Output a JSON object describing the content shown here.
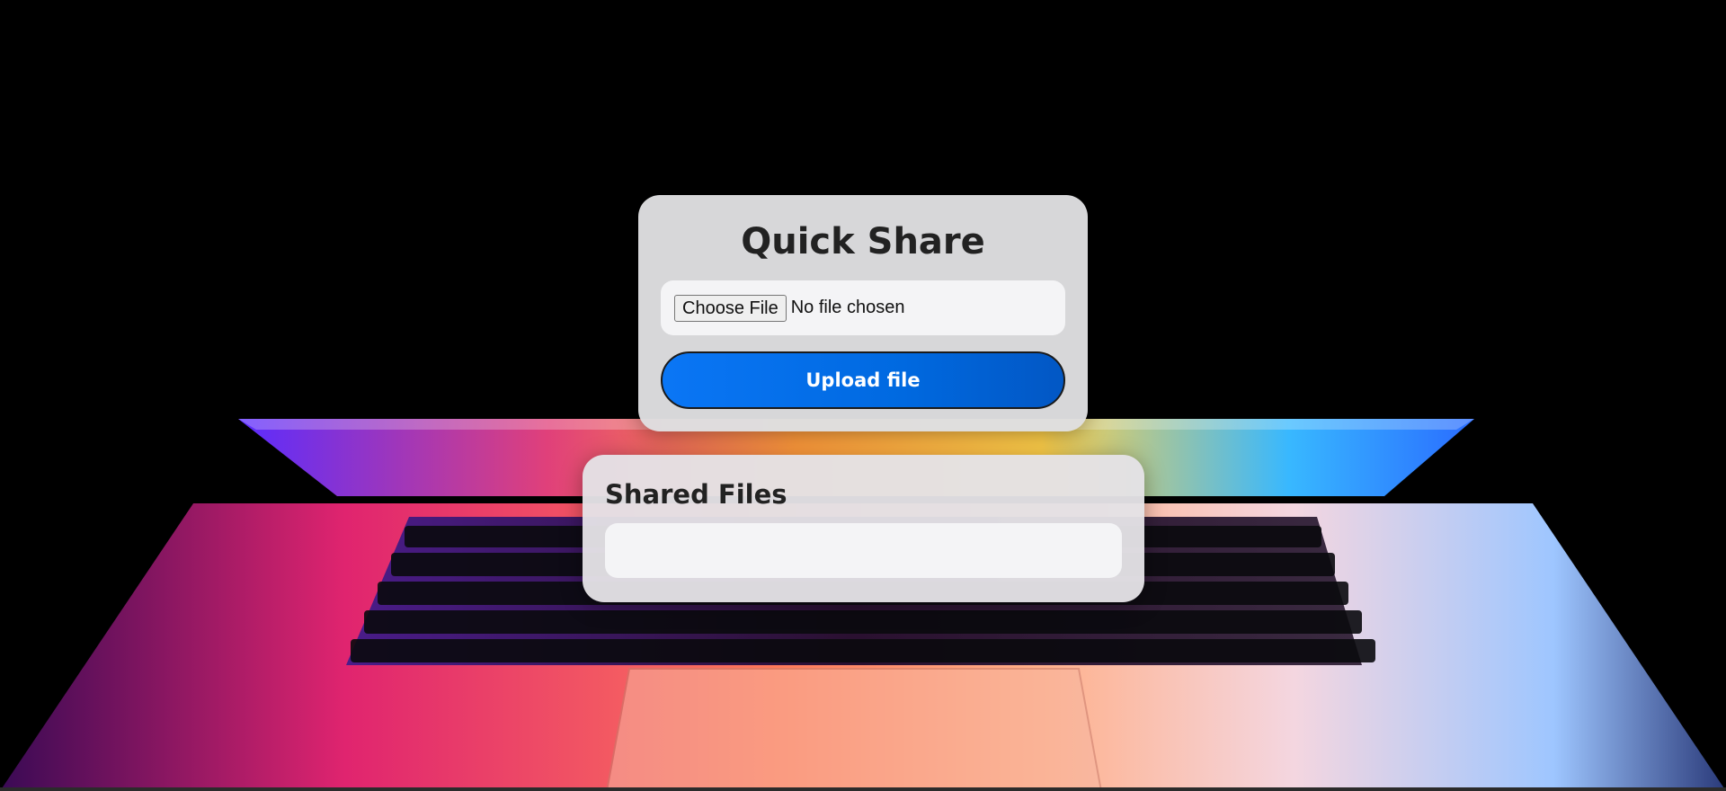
{
  "upload": {
    "title": "Quick Share",
    "choose_file_label": "Choose File",
    "no_file_text": "No file chosen",
    "upload_button_label": "Upload file"
  },
  "shared": {
    "title": "Shared Files",
    "files": []
  },
  "colors": {
    "accent": "#0a76f5",
    "card_bg": "#dedee0",
    "input_bg": "#f4f4f6"
  }
}
